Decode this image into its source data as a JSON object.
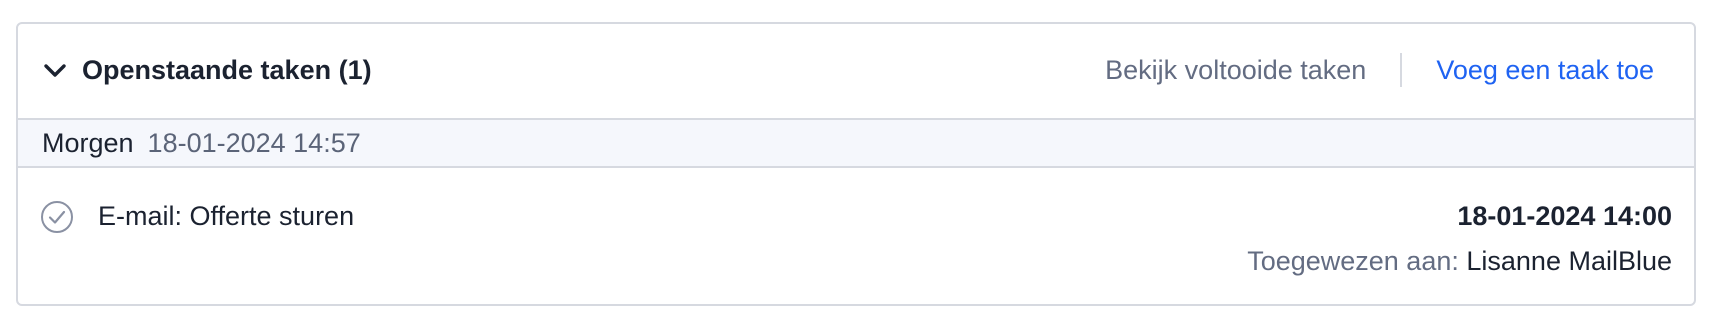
{
  "header": {
    "title": "Openstaande taken (1)",
    "view_completed": "Bekijk voltooide taken",
    "add_task": "Voeg een taak toe",
    "expand_icon": "chevron-down-icon"
  },
  "group": {
    "label": "Morgen",
    "date": "18-01-2024 14:57"
  },
  "tasks": [
    {
      "title": "E-mail: Offerte sturen",
      "due": "18-01-2024 14:00",
      "assigned_label": "Toegewezen aan:",
      "assignee": "Lisanne MailBlue",
      "status_icon": "check-circle-icon"
    }
  ],
  "colors": {
    "link_accent": "#1f63f2",
    "muted_text": "#636c82",
    "border": "#d6d9e0",
    "group_background": "#f5f7fc"
  }
}
